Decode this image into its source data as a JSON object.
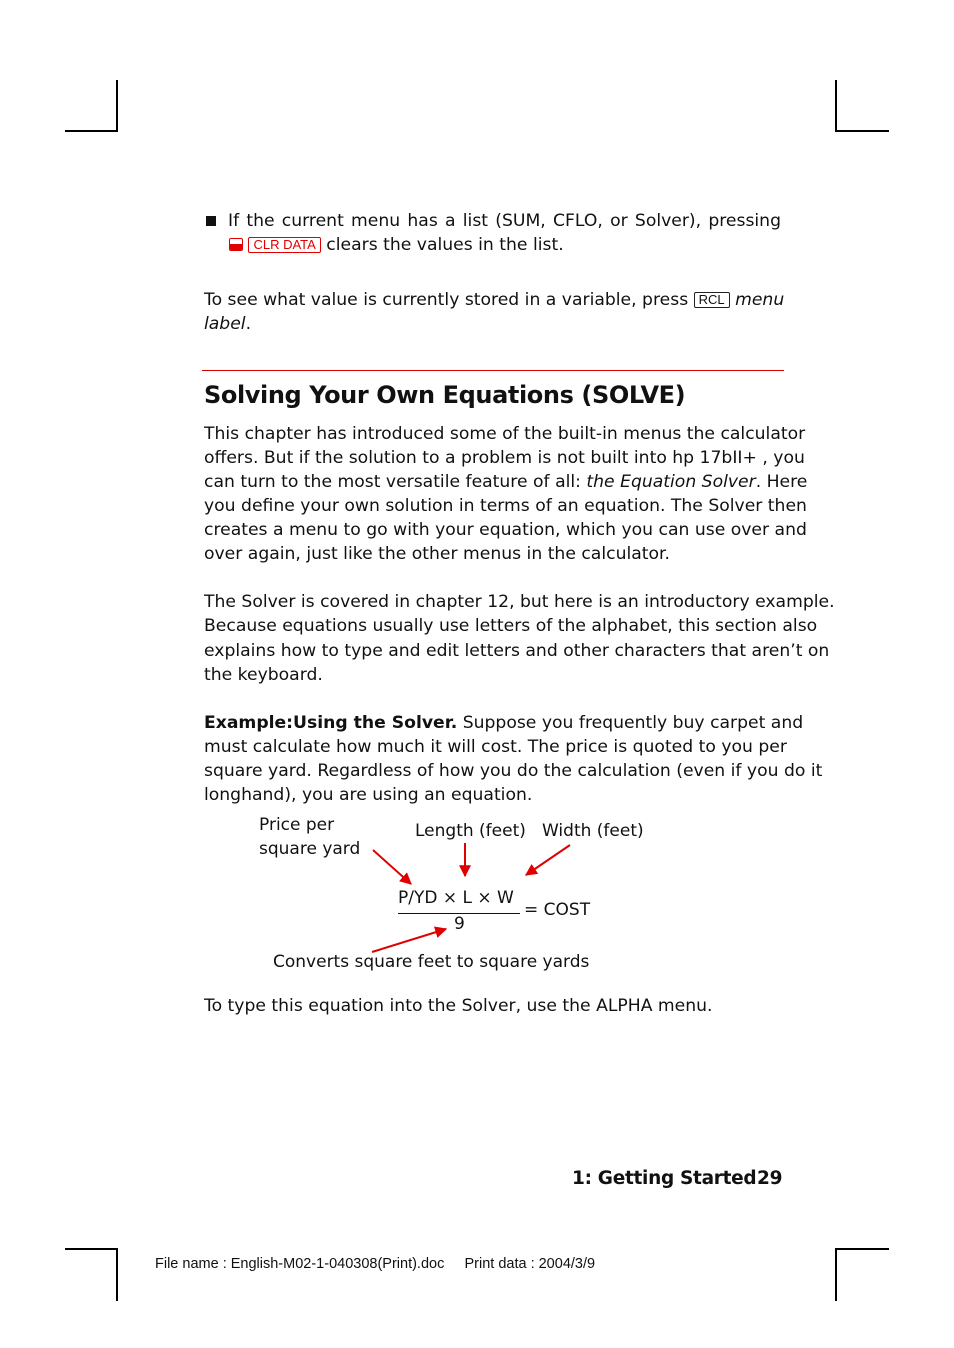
{
  "bullet_item": {
    "line1": "If the current menu has a list (SUM, CFLO, or Solver), pressing",
    "shift_key_icon": "red-shift-key",
    "key_label": "CLR DATA",
    "line2_rest": "clears the values in the list."
  },
  "rcl_para": {
    "text_before": "To see what value is currently stored in a variable, press",
    "key_label": "RCL",
    "italic_tail": "menu",
    "line2_italic": "label",
    "line2_end": "."
  },
  "section": {
    "title": "Solving Your Own Equations (SOLVE)",
    "accent_color": "#d40000"
  },
  "intro_para": {
    "l1": "This chapter has introduced some of the built-in menus the calculator",
    "l2": "offers. But if the solution to a problem is not built into hp 17bII+ , you",
    "l3_pre": "can turn to the most versatile feature of all:",
    "l3_italic": "the Equation Solver",
    "l3_post": ". Here",
    "l4": "you define your own solution in terms of an equation. The Solver then",
    "l5": "creates a menu to go with your equation, which you can use over and",
    "l6": "over again, just like the other menus in the calculator."
  },
  "solver_para": {
    "l1": "The Solver is covered in chapter 12, but here is an introductory example.",
    "l2": "Because equations usually use letters of the alphabet, this section also",
    "l3": "explains how to type and edit letters and other characters that aren’t on",
    "l4": "the keyboard."
  },
  "example_para": {
    "bold_lead": "Example:Using the Solver.",
    "l1_rest": "Suppose you frequently buy carpet and",
    "l2": "must calculate how much it will cost. The price is quoted to you per",
    "l3": "square yard. Regardless of how you do the calculation (even if you do it",
    "l4": "longhand), you are using an equation."
  },
  "diagram": {
    "label_price_1": "Price per",
    "label_price_2": "square yard",
    "label_length": "Length (feet)",
    "label_width": "Width (feet)",
    "numerator": "P/YD × L × W",
    "denominator": "9",
    "rhs": "= COST",
    "label_converts": "Converts square feet to square yards",
    "arrow_color": "#e00000"
  },
  "closing_para": "To type this equation into the Solver, use the ALPHA menu.",
  "footer": {
    "chapter": "1: Getting Started",
    "page_number": "29",
    "file_info": "File name : English-M02-1-040308(Print).doc     Print data : 2004/3/9"
  }
}
